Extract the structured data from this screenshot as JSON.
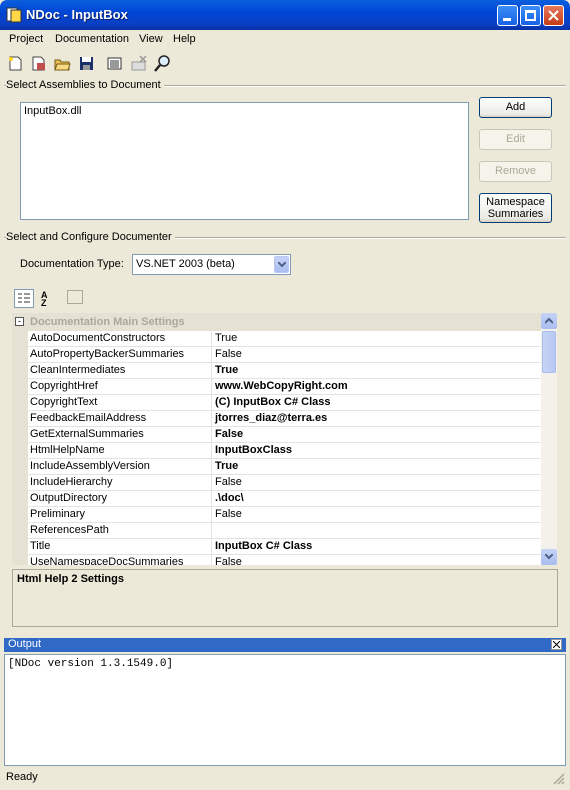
{
  "window": {
    "title": "NDoc - InputBox"
  },
  "menu": {
    "items": [
      "Project",
      "Documentation",
      "View",
      "Help"
    ]
  },
  "toolbar": {
    "icons": [
      "new-project-icon",
      "new-from-solution-icon",
      "open-icon",
      "save-icon",
      "build-icon",
      "cancel-build-icon",
      "view-icon"
    ]
  },
  "assemblies": {
    "section_label": "Select Assemblies to Document",
    "items": [
      "InputBox.dll"
    ],
    "buttons": {
      "add": "Add",
      "edit": "Edit",
      "remove": "Remove",
      "namespace": "Namespace Summaries"
    }
  },
  "documenter": {
    "section_label": "Select and Configure Documenter",
    "type_label": "Documentation Type:",
    "type_value": "VS.NET 2003 (beta)"
  },
  "property_grid": {
    "category": "Documentation Main Settings",
    "rows": [
      {
        "name": "AutoDocumentConstructors",
        "value": "True",
        "bold": false
      },
      {
        "name": "AutoPropertyBackerSummaries",
        "value": "False",
        "bold": false
      },
      {
        "name": "CleanIntermediates",
        "value": "True",
        "bold": true
      },
      {
        "name": "CopyrightHref",
        "value": "www.WebCopyRight.com",
        "bold": true
      },
      {
        "name": "CopyrightText",
        "value": "(C) InputBox C# Class",
        "bold": true
      },
      {
        "name": "FeedbackEmailAddress",
        "value": "jtorres_diaz@terra.es",
        "bold": true
      },
      {
        "name": "GetExternalSummaries",
        "value": "False",
        "bold": true
      },
      {
        "name": "HtmlHelpName",
        "value": "InputBoxClass",
        "bold": true
      },
      {
        "name": "IncludeAssemblyVersion",
        "value": "True",
        "bold": true
      },
      {
        "name": "IncludeHierarchy",
        "value": "False",
        "bold": false
      },
      {
        "name": "OutputDirectory",
        "value": ".\\doc\\",
        "bold": true
      },
      {
        "name": "Preliminary",
        "value": "False",
        "bold": false
      },
      {
        "name": "ReferencesPath",
        "value": "",
        "bold": false
      },
      {
        "name": "Title",
        "value": "InputBox C# Class",
        "bold": true
      },
      {
        "name": "UseNamespaceDocSummaries",
        "value": "False",
        "bold": false
      }
    ],
    "description_title": "Html Help 2 Settings"
  },
  "output": {
    "title": "Output",
    "text": "[NDoc version 1.3.1549.0]"
  },
  "status": {
    "text": "Ready"
  },
  "colors": {
    "titlebar": "#0a5fdc",
    "output_header": "#3169c6",
    "selection": "#316ac5"
  }
}
